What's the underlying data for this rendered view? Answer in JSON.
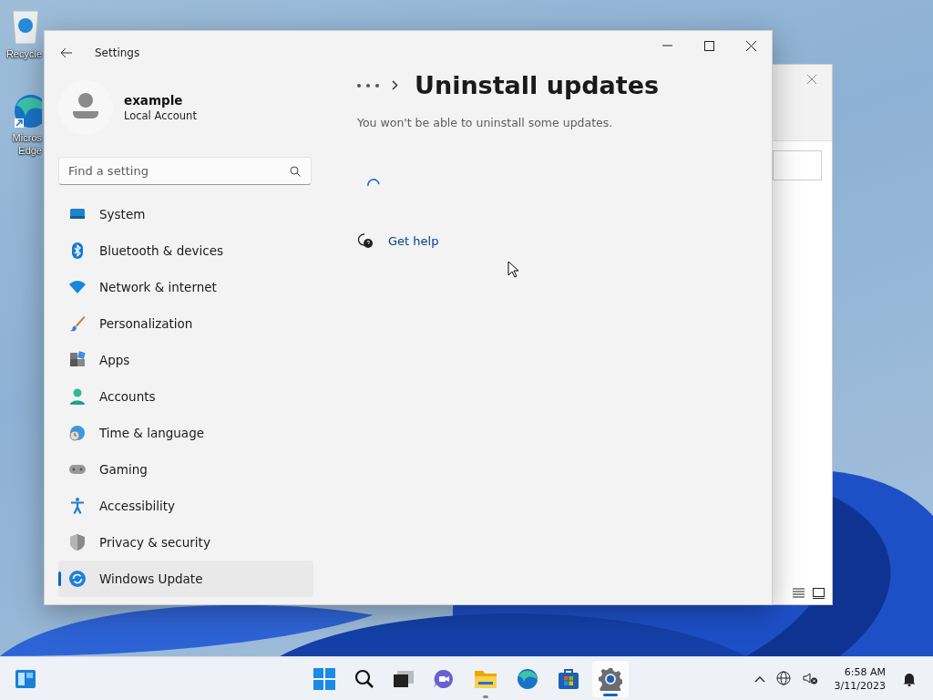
{
  "desktop_icons": [
    {
      "label": "Recycle"
    },
    {
      "label": "Micros\nEdge"
    }
  ],
  "settings": {
    "title": "Settings",
    "account": {
      "name": "example",
      "type": "Local Account"
    },
    "search": {
      "placeholder": "Find a setting"
    },
    "nav": [
      {
        "label": "System",
        "selected": false
      },
      {
        "label": "Bluetooth & devices",
        "selected": false
      },
      {
        "label": "Network & internet",
        "selected": false
      },
      {
        "label": "Personalization",
        "selected": false
      },
      {
        "label": "Apps",
        "selected": false
      },
      {
        "label": "Accounts",
        "selected": false
      },
      {
        "label": "Time & language",
        "selected": false
      },
      {
        "label": "Gaming",
        "selected": false
      },
      {
        "label": "Accessibility",
        "selected": false
      },
      {
        "label": "Privacy & security",
        "selected": false
      },
      {
        "label": "Windows Update",
        "selected": true
      }
    ],
    "page_title": "Uninstall updates",
    "description": "You won't be able to uninstall some updates.",
    "help_link": "Get help"
  },
  "taskbar": {
    "time": "6:58 AM",
    "date": "3/11/2023"
  }
}
